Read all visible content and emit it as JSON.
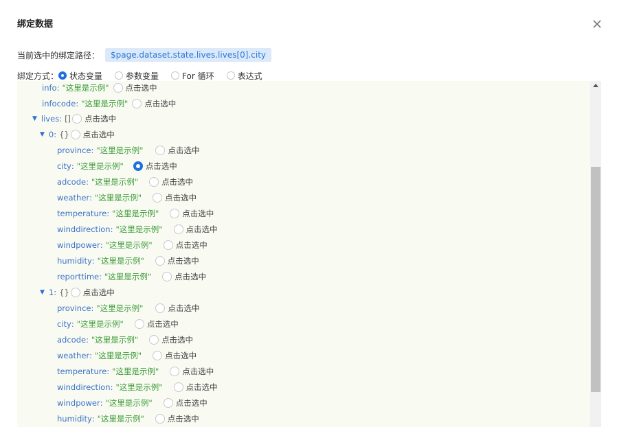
{
  "dialog": {
    "title": "绑定数据",
    "close_icon": "close-icon"
  },
  "path": {
    "label": "当前选中的绑定路径：",
    "value": "$page.dataset.state.lives.lives[0].city"
  },
  "mode": {
    "label": "绑定方式：",
    "options": [
      {
        "label": "状态变量",
        "checked": true
      },
      {
        "label": "参数变量",
        "checked": false
      },
      {
        "label": "For 循环",
        "checked": false
      },
      {
        "label": "表达式",
        "checked": false
      }
    ]
  },
  "pick_label": "点击选中",
  "tree": {
    "info": {
      "key": "info",
      "value": "\"这里是示例\""
    },
    "infocode": {
      "key": "infocode",
      "value": "\"这里是示例\""
    },
    "lives": {
      "key": "lives",
      "value": "[]"
    },
    "item0": {
      "key": "0",
      "value": "{}",
      "fields": [
        {
          "key": "province",
          "value": "\"这里是示例\""
        },
        {
          "key": "city",
          "value": "\"这里是示例\"",
          "checked": true
        },
        {
          "key": "adcode",
          "value": "\"这里是示例\""
        },
        {
          "key": "weather",
          "value": "\"这里是示例\""
        },
        {
          "key": "temperature",
          "value": "\"这里是示例\""
        },
        {
          "key": "winddirection",
          "value": "\"这里是示例\""
        },
        {
          "key": "windpower",
          "value": "\"这里是示例\""
        },
        {
          "key": "humidity",
          "value": "\"这里是示例\""
        },
        {
          "key": "reporttime",
          "value": "\"这里是示例\""
        }
      ]
    },
    "item1": {
      "key": "1",
      "value": "{}",
      "fields": [
        {
          "key": "province",
          "value": "\"这里是示例\""
        },
        {
          "key": "city",
          "value": "\"这里是示例\""
        },
        {
          "key": "adcode",
          "value": "\"这里是示例\""
        },
        {
          "key": "weather",
          "value": "\"这里是示例\""
        },
        {
          "key": "temperature",
          "value": "\"这里是示例\""
        },
        {
          "key": "winddirection",
          "value": "\"这里是示例\""
        },
        {
          "key": "windpower",
          "value": "\"这里是示例\""
        },
        {
          "key": "humidity",
          "value": "\"这里是示例\""
        }
      ]
    }
  },
  "colors": {
    "accent": "#1f6fe0",
    "key": "#3a70c4",
    "string": "#3a9a36",
    "panel_bg": "#f9fbf3",
    "path_bg": "#dbe9fb"
  }
}
